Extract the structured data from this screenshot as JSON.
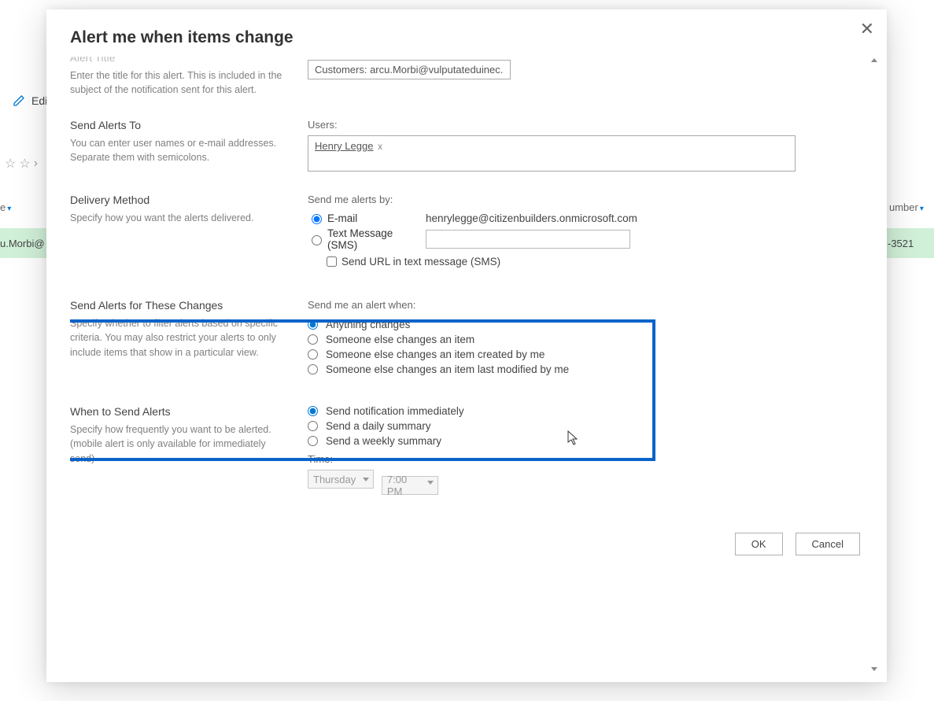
{
  "background": {
    "edit_label": "Edi",
    "head_left": "e",
    "head_right": "umber",
    "row_left": "u.Morbi@",
    "row_right": "-3521"
  },
  "dialog": {
    "title": "Alert me when items change"
  },
  "alert_title": {
    "heading_clipped": "Alert Title",
    "desc": "Enter the title for this alert. This is included in the subject of the notification sent for this alert.",
    "value": "Customers: arcu.Morbi@vulputateduinec."
  },
  "send_to": {
    "heading": "Send Alerts To",
    "desc": "You can enter user names or e-mail addresses. Separate them with semicolons.",
    "label": "Users:",
    "chip": "Henry Legge",
    "chip_x": "x"
  },
  "delivery": {
    "heading": "Delivery Method",
    "desc": "Specify how you want the alerts delivered.",
    "label": "Send me alerts by:",
    "opt_email": "E-mail",
    "email_value": "henrylegge@citizenbuilders.onmicrosoft.com",
    "opt_sms": "Text Message (SMS)",
    "chk_url": "Send URL in text message (SMS)"
  },
  "changes": {
    "heading": "Send Alerts for These Changes",
    "desc": "Specify whether to filter alerts based on specific criteria. You may also restrict your alerts to only include items that show in a particular view.",
    "label": "Send me an alert when:",
    "opts": [
      "Anything changes",
      "Someone else changes an item",
      "Someone else changes an item created by me",
      "Someone else changes an item last modified by me"
    ]
  },
  "when": {
    "heading": "When to Send Alerts",
    "desc": "Specify how frequently you want to be alerted. (mobile alert is only available for immediately send)",
    "opts": [
      "Send notification immediately",
      "Send a daily summary",
      "Send a weekly summary"
    ],
    "time_label": "Time:",
    "day": "Thursday",
    "time": "7:00 PM"
  },
  "buttons": {
    "ok": "OK",
    "cancel": "Cancel"
  }
}
